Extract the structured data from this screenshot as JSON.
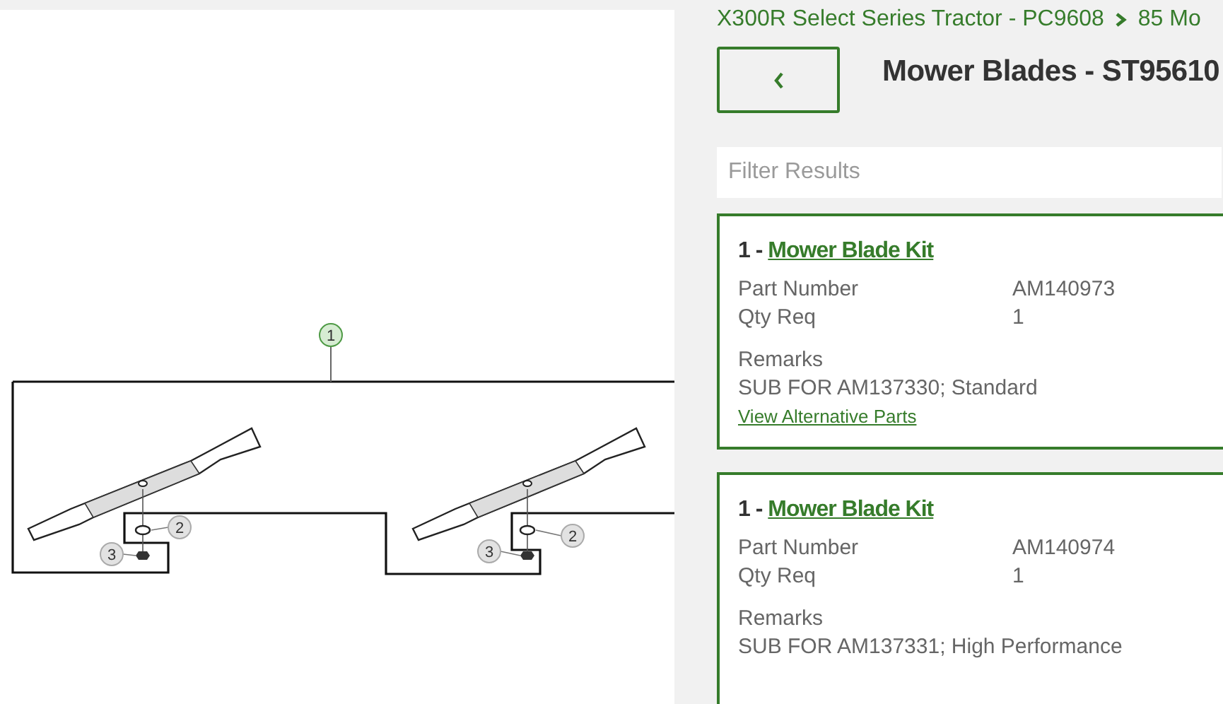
{
  "diagram": {
    "callouts": [
      {
        "label": "1"
      },
      {
        "label": "2"
      },
      {
        "label": "3"
      },
      {
        "label": "2"
      },
      {
        "label": "3"
      }
    ]
  },
  "breadcrumb": [
    {
      "label": "X300R Select Series Tractor - PC9608"
    },
    {
      "label": "85 Mo"
    }
  ],
  "title": "Mower Blades - ST95610",
  "filter": {
    "placeholder": "Filter Results"
  },
  "parts": [
    {
      "index": "1 -",
      "name": "Mower Blade Kit",
      "fields": [
        {
          "label": "Part Number",
          "value": "AM140973"
        },
        {
          "label": "Qty Req",
          "value": "1"
        }
      ],
      "remarks_label": "Remarks",
      "remarks": "SUB FOR AM137330; Standard",
      "link": "View Alternative Parts"
    },
    {
      "index": "1 -",
      "name": "Mower Blade Kit",
      "fields": [
        {
          "label": "Part Number",
          "value": "AM140974"
        },
        {
          "label": "Qty Req",
          "value": "1"
        }
      ],
      "remarks_label": "Remarks",
      "remarks": "SUB FOR AM137331; High Performance"
    }
  ]
}
